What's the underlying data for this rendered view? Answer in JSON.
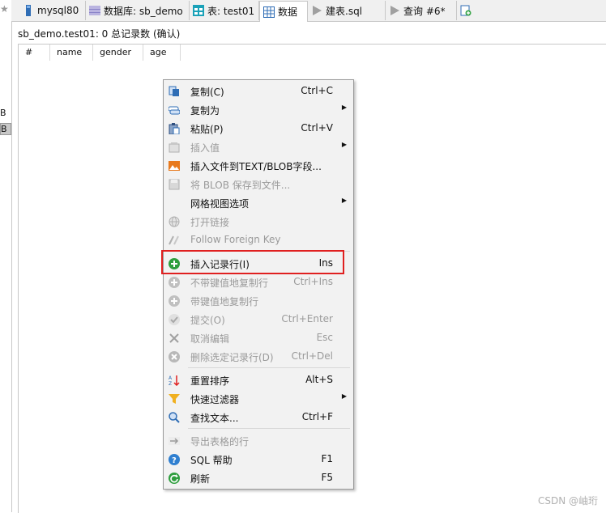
{
  "left_strip": {
    "star": "★",
    "label1": "B",
    "label2": "B"
  },
  "tabs": [
    {
      "label": "mysql80",
      "icon": "mysql-connection-icon"
    },
    {
      "label": "数据库: sb_demo",
      "icon": "database-icon"
    },
    {
      "label": "表: test01",
      "icon": "table-icon"
    },
    {
      "label": "数据",
      "icon": "data-grid-icon",
      "active": true
    },
    {
      "label": "建表.sql",
      "icon": "sql-script-icon"
    },
    {
      "label": "查询 #6*",
      "icon": "query-icon"
    },
    {
      "label": "",
      "icon": "new-tab-icon"
    }
  ],
  "info_line": "sb_demo.test01: 0 总记录数 (确认)",
  "columns": [
    "#",
    "name",
    "gender",
    "age"
  ],
  "menu": {
    "items": [
      {
        "label": "复制(C)",
        "shortcut": "Ctrl+C",
        "icon": "copy-icon",
        "enabled": true
      },
      {
        "label": "复制为",
        "shortcut": "",
        "icon": "copy-as-icon",
        "enabled": true,
        "submenu": true
      },
      {
        "label": "粘贴(P)",
        "shortcut": "Ctrl+V",
        "icon": "paste-icon",
        "enabled": true
      },
      {
        "label": "插入值",
        "shortcut": "",
        "icon": "insert-value-icon",
        "enabled": false,
        "submenu": true
      },
      {
        "label": "插入文件到TEXT/BLOB字段...",
        "shortcut": "",
        "icon": "insert-file-icon",
        "enabled": true
      },
      {
        "label": "将 BLOB 保存到文件...",
        "shortcut": "",
        "icon": "save-blob-icon",
        "enabled": false
      },
      {
        "label": "网格视图选项",
        "shortcut": "",
        "icon": "",
        "enabled": true,
        "submenu": true
      },
      {
        "label": "打开链接",
        "shortcut": "",
        "icon": "globe-icon",
        "enabled": false
      },
      {
        "label": "Follow Foreign Key",
        "shortcut": "",
        "icon": "foreign-key-icon",
        "enabled": false
      },
      {
        "label": "插入记录行(I)",
        "shortcut": "Ins",
        "icon": "plus-circle-icon",
        "enabled": true
      },
      {
        "label": "不带键值地复制行",
        "shortcut": "Ctrl+Ins",
        "icon": "plus-circle-gray-icon",
        "enabled": false
      },
      {
        "label": "带键值地复制行",
        "shortcut": "",
        "icon": "plus-circle-gray-icon",
        "enabled": false
      },
      {
        "label": "提交(O)",
        "shortcut": "Ctrl+Enter",
        "icon": "check-icon",
        "enabled": false
      },
      {
        "label": "取消编辑",
        "shortcut": "Esc",
        "icon": "x-icon",
        "enabled": false
      },
      {
        "label": "删除选定记录行(D)",
        "shortcut": "Ctrl+Del",
        "icon": "x-circle-icon",
        "enabled": false
      },
      {
        "label": "重置排序",
        "shortcut": "Alt+S",
        "icon": "sort-icon",
        "enabled": true
      },
      {
        "label": "快速过滤器",
        "shortcut": "",
        "icon": "funnel-icon",
        "enabled": true,
        "submenu": true
      },
      {
        "label": "查找文本...",
        "shortcut": "Ctrl+F",
        "icon": "magnifier-icon",
        "enabled": true
      },
      {
        "label": "导出表格的行",
        "shortcut": "",
        "icon": "export-icon",
        "enabled": false
      },
      {
        "label": "SQL 帮助",
        "shortcut": "F1",
        "icon": "help-icon",
        "enabled": true
      },
      {
        "label": "刷新",
        "shortcut": "F5",
        "icon": "refresh-icon",
        "enabled": true
      }
    ],
    "submenu_arrow": "▶"
  },
  "watermark": "CSDN @岫珩",
  "colors": {
    "highlight_border": "#e02020",
    "menu_bg": "#f2f2f2",
    "disabled_text": "#9a9a9a"
  }
}
